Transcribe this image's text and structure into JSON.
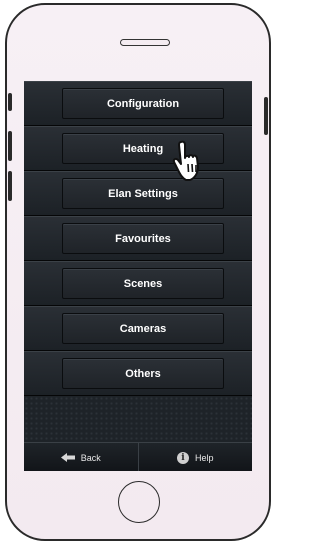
{
  "menu": {
    "items": [
      {
        "label": "Configuration"
      },
      {
        "label": "Heating"
      },
      {
        "label": "Elan Settings"
      },
      {
        "label": "Favourites"
      },
      {
        "label": "Scenes"
      },
      {
        "label": "Cameras"
      },
      {
        "label": "Others"
      }
    ]
  },
  "bottom_bar": {
    "back_label": "Back",
    "help_label": "Help"
  },
  "colors": {
    "screen_bg": "#111417",
    "button_text": "#ffffff",
    "phone_frame": "#2a2a2a"
  },
  "icons": {
    "back": "back-arrow-icon",
    "help": "info-icon",
    "pointer": "hand-pointer-icon"
  }
}
